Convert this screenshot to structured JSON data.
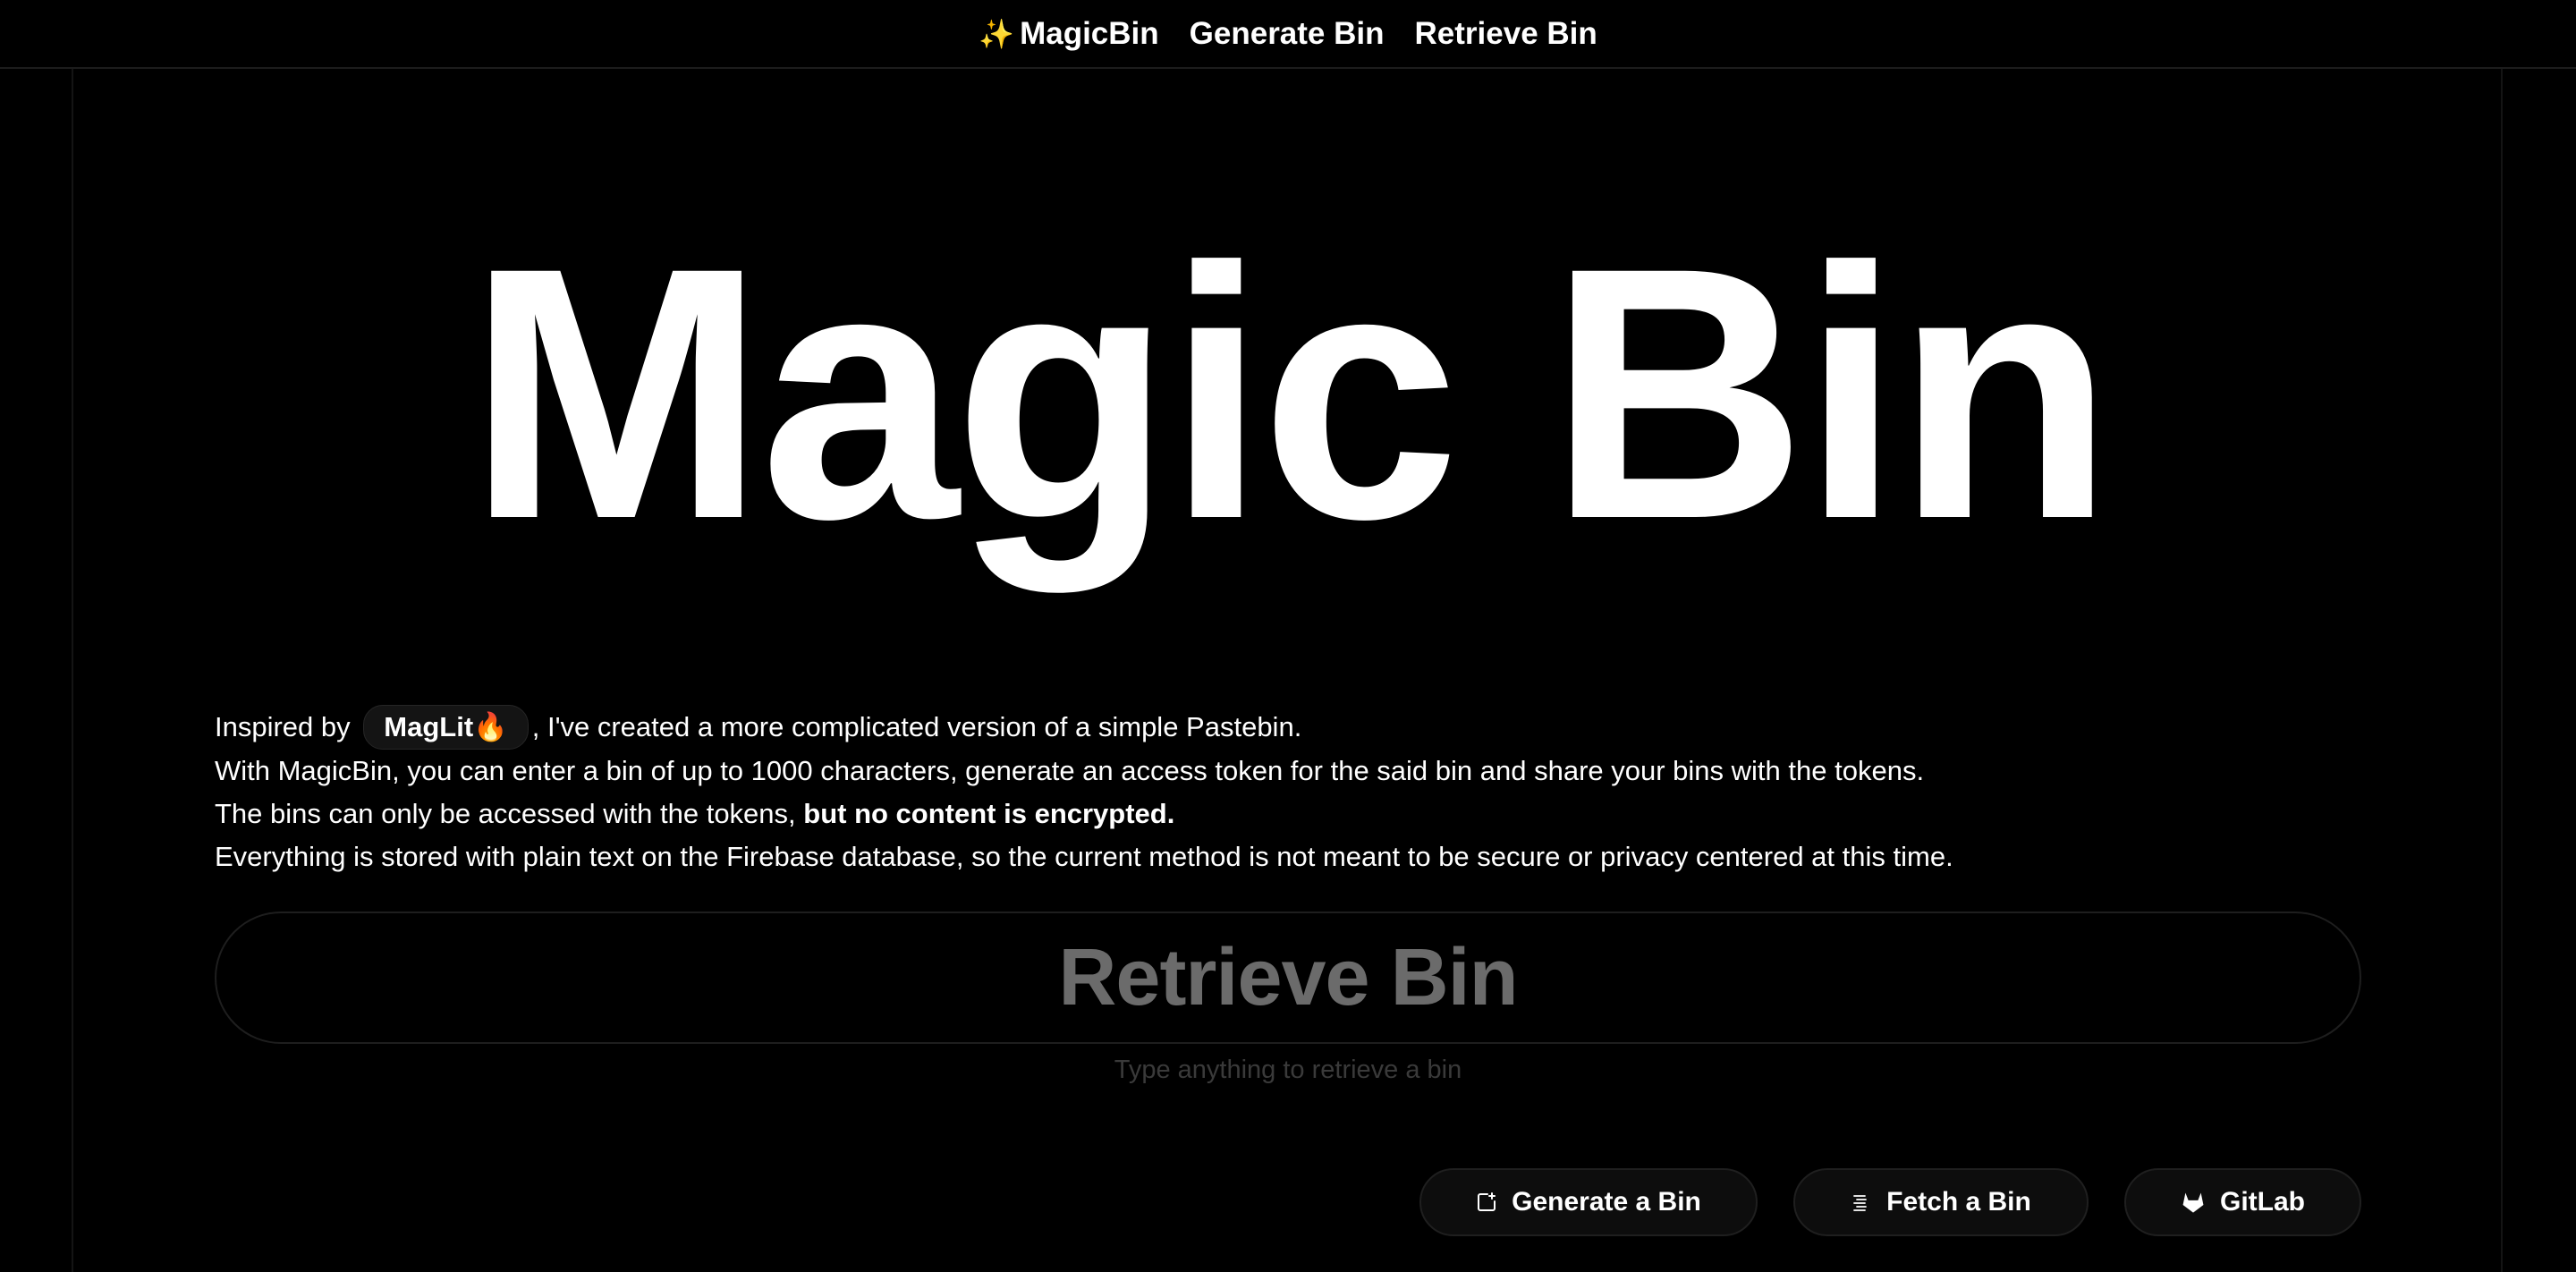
{
  "nav": {
    "brand_icon": "sparkles-icon",
    "brand": "MagicBin",
    "items": [
      {
        "label": "Generate Bin"
      },
      {
        "label": "Retrieve Bin"
      }
    ]
  },
  "hero": {
    "title": "Magic Bin"
  },
  "intro": {
    "line1_prefix": "Inspired by",
    "maglit_label": "MagLit",
    "maglit_icon": "fire-icon",
    "line1_suffix": ", I've created a more complicated version of a simple Pastebin.",
    "line2": "With MagicBin, you can enter a bin of up to 1000 characters, generate an access token for the said bin and share your bins with the tokens.",
    "line3_prefix": "The bins can only be accessed with the tokens, ",
    "line3_bold": "but no content is encrypted.",
    "line4": "Everything is stored with plain text on the Firebase database, so the current method is not meant to be secure or privacy centered at this time."
  },
  "retrieve": {
    "placeholder": "Retrieve Bin",
    "helper": "Type anything to retrieve a bin"
  },
  "buttons": {
    "generate": {
      "label": "Generate a Bin",
      "icon": "new-window-icon"
    },
    "fetch": {
      "label": "Fetch a Bin",
      "icon": "text-lines-icon"
    },
    "gitlab": {
      "label": "GitLab",
      "icon": "gitlab-icon"
    }
  },
  "colors": {
    "background": "#000000",
    "text": "#ffffff",
    "muted": "#6b6b6b",
    "border": "#1e1e1e"
  }
}
